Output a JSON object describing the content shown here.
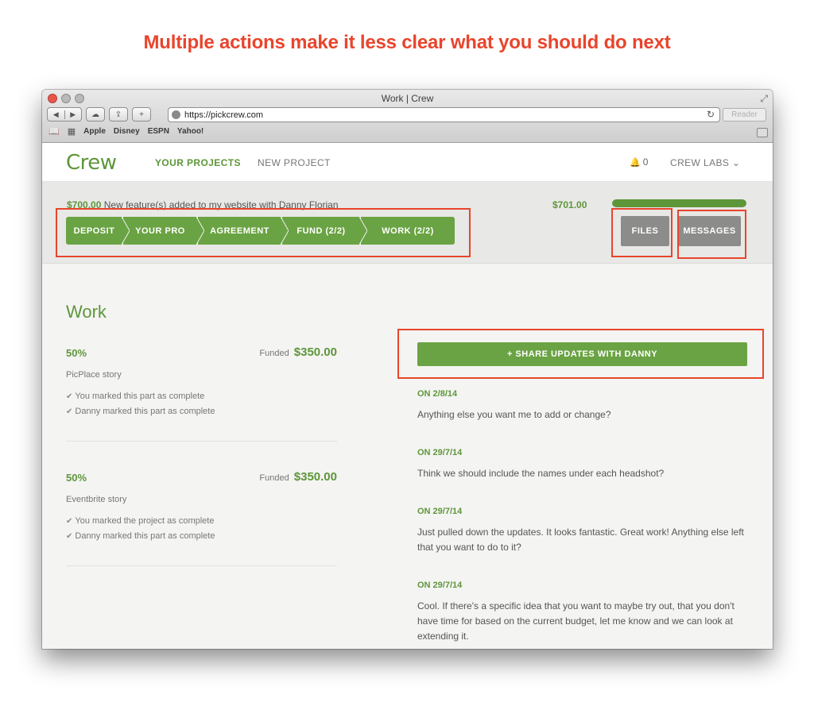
{
  "caption": "Multiple actions make it less clear what you should do next",
  "browser": {
    "title": "Work | Crew",
    "url": "https://pickcrew.com",
    "reader_label": "Reader",
    "bookmarks": [
      "Apple",
      "Disney",
      "ESPN",
      "Yahoo!"
    ]
  },
  "site": {
    "logo": "Crew",
    "nav": {
      "your_projects": "YOUR PROJECTS",
      "new_project": "NEW PROJECT"
    },
    "notifications_count": "0",
    "team_menu": "CREW LABS"
  },
  "project": {
    "amount": "$700.00",
    "description": "New feature(s) added to my website with Danny Florian",
    "total": "$701.00",
    "progress": 1.0,
    "steps": [
      "DEPOSIT",
      "YOUR PRO",
      "AGREEMENT",
      "FUND (2/2)",
      "WORK (2/2)"
    ],
    "files_label": "FILES",
    "messages_label": "MESSAGES"
  },
  "work": {
    "title": "Work",
    "funded_label": "Funded",
    "parts": [
      {
        "percent": "50%",
        "funded_amount": "$350.00",
        "name": "PicPlace story",
        "checks": [
          "You marked this part as complete",
          "Danny marked this part as complete"
        ]
      },
      {
        "percent": "50%",
        "funded_amount": "$350.00",
        "name": "Eventbrite story",
        "checks": [
          "You marked the project as complete",
          "Danny marked this part as complete"
        ]
      }
    ],
    "share_button": "+ SHARE UPDATES WITH DANNY",
    "updates": [
      {
        "date": "ON 2/8/14",
        "text": "Anything else you want me to add or change?"
      },
      {
        "date": "ON 29/7/14",
        "text": "Think we should include the names under each headshot?"
      },
      {
        "date": "ON 29/7/14",
        "text": "Just pulled down the updates. It looks fantastic. Great work! Anything else left that you want to do to it?"
      },
      {
        "date": "ON 29/7/14",
        "text": "Cool. If there's a specific idea that you want to maybe try out, that you don't have time for based on the current budget, let me know and we can look at extending it."
      }
    ]
  },
  "colors": {
    "brand_green": "#5e963a",
    "highlight_red": "#e8452c"
  }
}
